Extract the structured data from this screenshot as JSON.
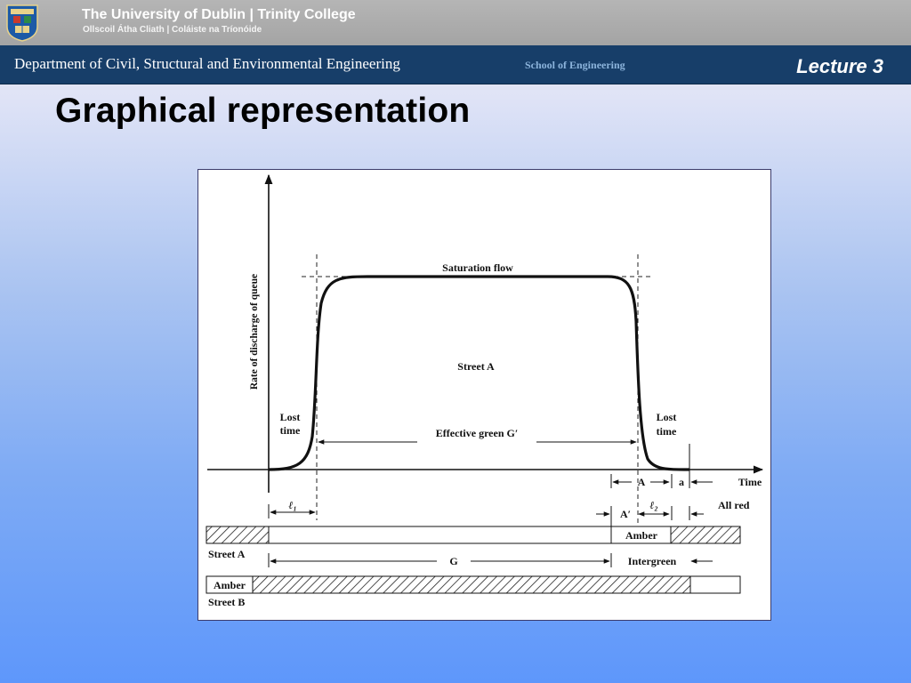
{
  "header": {
    "university_title": "The University of Dublin | Trinity College",
    "university_subtitle": "Ollscoil Átha Cliath | Coláiste na Tríonóide",
    "department": "Department of Civil, Structural and Environmental Engineering",
    "school": "School of Engineering",
    "lecture": "Lecture 3"
  },
  "slide": {
    "title": "Graphical representation"
  },
  "diagram": {
    "y_axis_label": "Rate of discharge of queue",
    "x_axis_label": "Time",
    "saturation_flow": "Saturation flow",
    "street_a_curve": "Street A",
    "lost_time_left_1": "Lost",
    "lost_time_left_2": "time",
    "lost_time_right_1": "Lost",
    "lost_time_right_2": "time",
    "effective_green": "Effective green G′",
    "label_A": "A",
    "label_a": "a",
    "label_A_prime": "A′",
    "label_l1": "ℓ₁",
    "label_l2": "ℓ₂",
    "all_red": "All red",
    "amber_a": "Amber",
    "street_a_row": "Street A",
    "label_G": "G",
    "intergreen": "Intergreen",
    "amber_b": "Amber",
    "street_b_row": "Street B"
  },
  "colors": {
    "dept_bar": "#173e69",
    "school_text": "#8cb4dc",
    "figure_border": "#3b3b6b"
  }
}
